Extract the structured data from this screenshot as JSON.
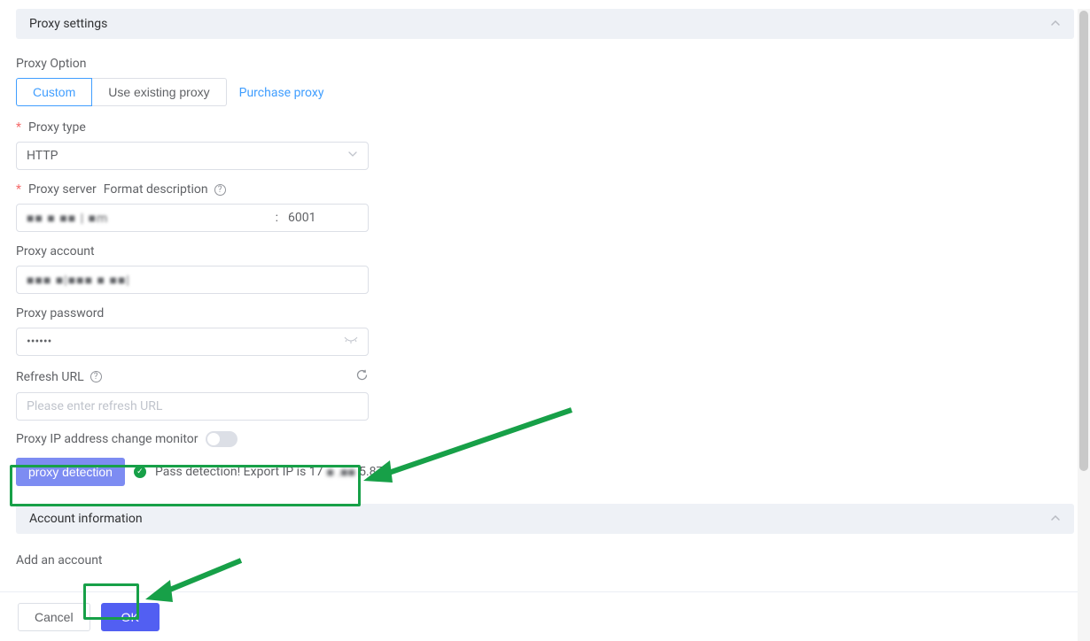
{
  "sections": {
    "proxySettings": {
      "title": "Proxy settings"
    },
    "accountInfo": {
      "title": "Account information"
    }
  },
  "proxyOption": {
    "label": "Proxy Option",
    "tabs": {
      "custom": "Custom",
      "existing": "Use existing proxy"
    },
    "purchaseLink": "Purchase proxy"
  },
  "proxyType": {
    "label": "Proxy type",
    "value": "HTTP"
  },
  "proxyServer": {
    "label": "Proxy server",
    "formatLabel": "Format description",
    "host": "■■ ■ ■■ | ■m",
    "port": "6001"
  },
  "proxyAccount": {
    "label": "Proxy account",
    "value": "■■■ ■|■■■ ■ ■■|"
  },
  "proxyPassword": {
    "label": "Proxy password",
    "value": "••••••"
  },
  "refreshUrl": {
    "label": "Refresh URL",
    "placeholder": "Please enter refresh URL"
  },
  "ipMonitor": {
    "label": "Proxy IP address change monitor"
  },
  "detection": {
    "button": "proxy detection",
    "prefix": "Pass detection! Export IP is 17",
    "blurPart": "■ .■■",
    "suffix": "5.87"
  },
  "addAccount": {
    "label": "Add an account"
  },
  "footer": {
    "cancel": "Cancel",
    "ok": "OK"
  }
}
